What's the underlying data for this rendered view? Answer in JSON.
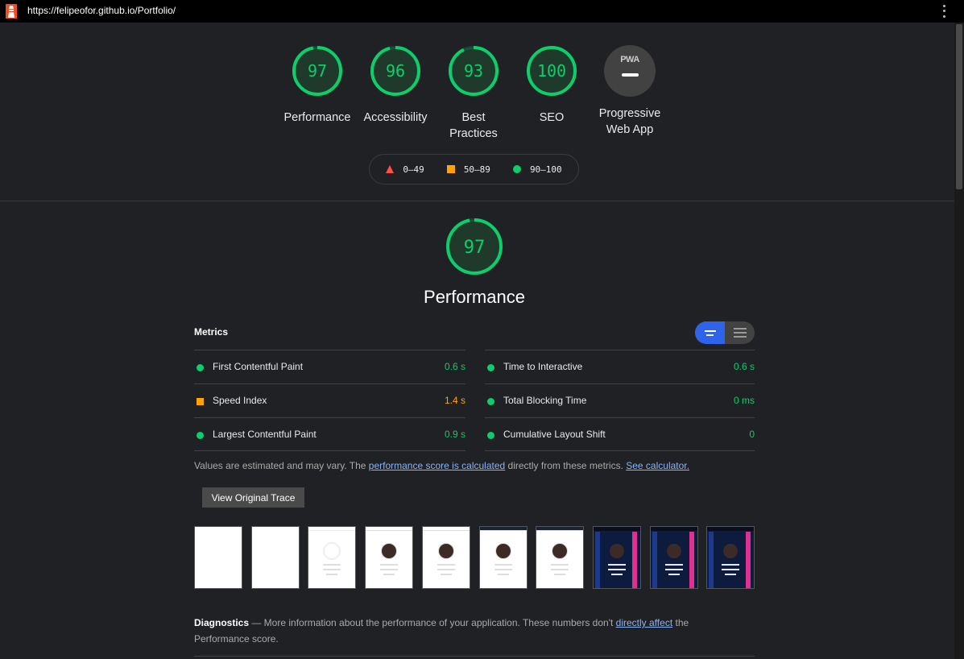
{
  "browser": {
    "url": "https://felipeofor.github.io/Portfolio/",
    "logo_icon": "lighthouse-icon",
    "menu_icon": "kebab-menu-icon"
  },
  "categories": [
    {
      "label_line1": "Performance",
      "label_line2": "",
      "score": 97
    },
    {
      "label_line1": "Accessibility",
      "label_line2": "",
      "score": 96
    },
    {
      "label_line1": "Best",
      "label_line2": "Practices",
      "score": 93
    },
    {
      "label_line1": "SEO",
      "label_line2": "",
      "score": 100
    },
    {
      "label_line1": "Progressive",
      "label_line2": "Web App",
      "badge": "PWA"
    }
  ],
  "legend": {
    "fail": "0–49",
    "average": "50–89",
    "pass": "90–100"
  },
  "colors": {
    "pass": "#0cce6b",
    "average": "#ffa400",
    "fail": "#ff4e42",
    "toggle_active": "#2f63ea"
  },
  "performance": {
    "score": 97,
    "title": "Performance",
    "metrics_heading": "Metrics",
    "metrics_left": [
      {
        "label": "First Contentful Paint",
        "value": "0.6 s",
        "status": "pass"
      },
      {
        "label": "Speed Index",
        "value": "1.4 s",
        "status": "average"
      },
      {
        "label": "Largest Contentful Paint",
        "value": "0.9 s",
        "status": "pass"
      }
    ],
    "metrics_right": [
      {
        "label": "Time to Interactive",
        "value": "0.6 s",
        "status": "pass"
      },
      {
        "label": "Total Blocking Time",
        "value": "0 ms",
        "status": "pass"
      },
      {
        "label": "Cumulative Layout Shift",
        "value": "0",
        "status": "pass"
      }
    ],
    "note_prefix": "Values are estimated and may vary. The ",
    "note_link1": "performance score is calculated",
    "note_middle": " directly from these metrics. ",
    "note_link2": "See calculator.",
    "trace_button": "View Original Trace",
    "filmstrip_frames": [
      "blank",
      "blank",
      "loading",
      "avatar",
      "avatar",
      "avatar",
      "avatar",
      "dark",
      "dark",
      "dark"
    ],
    "diagnostics_title": "Diagnostics",
    "diagnostics_prefix": " — More information about the performance of your application. These numbers don't ",
    "diagnostics_link": "directly affect",
    "diagnostics_suffix": " the Performance score."
  }
}
